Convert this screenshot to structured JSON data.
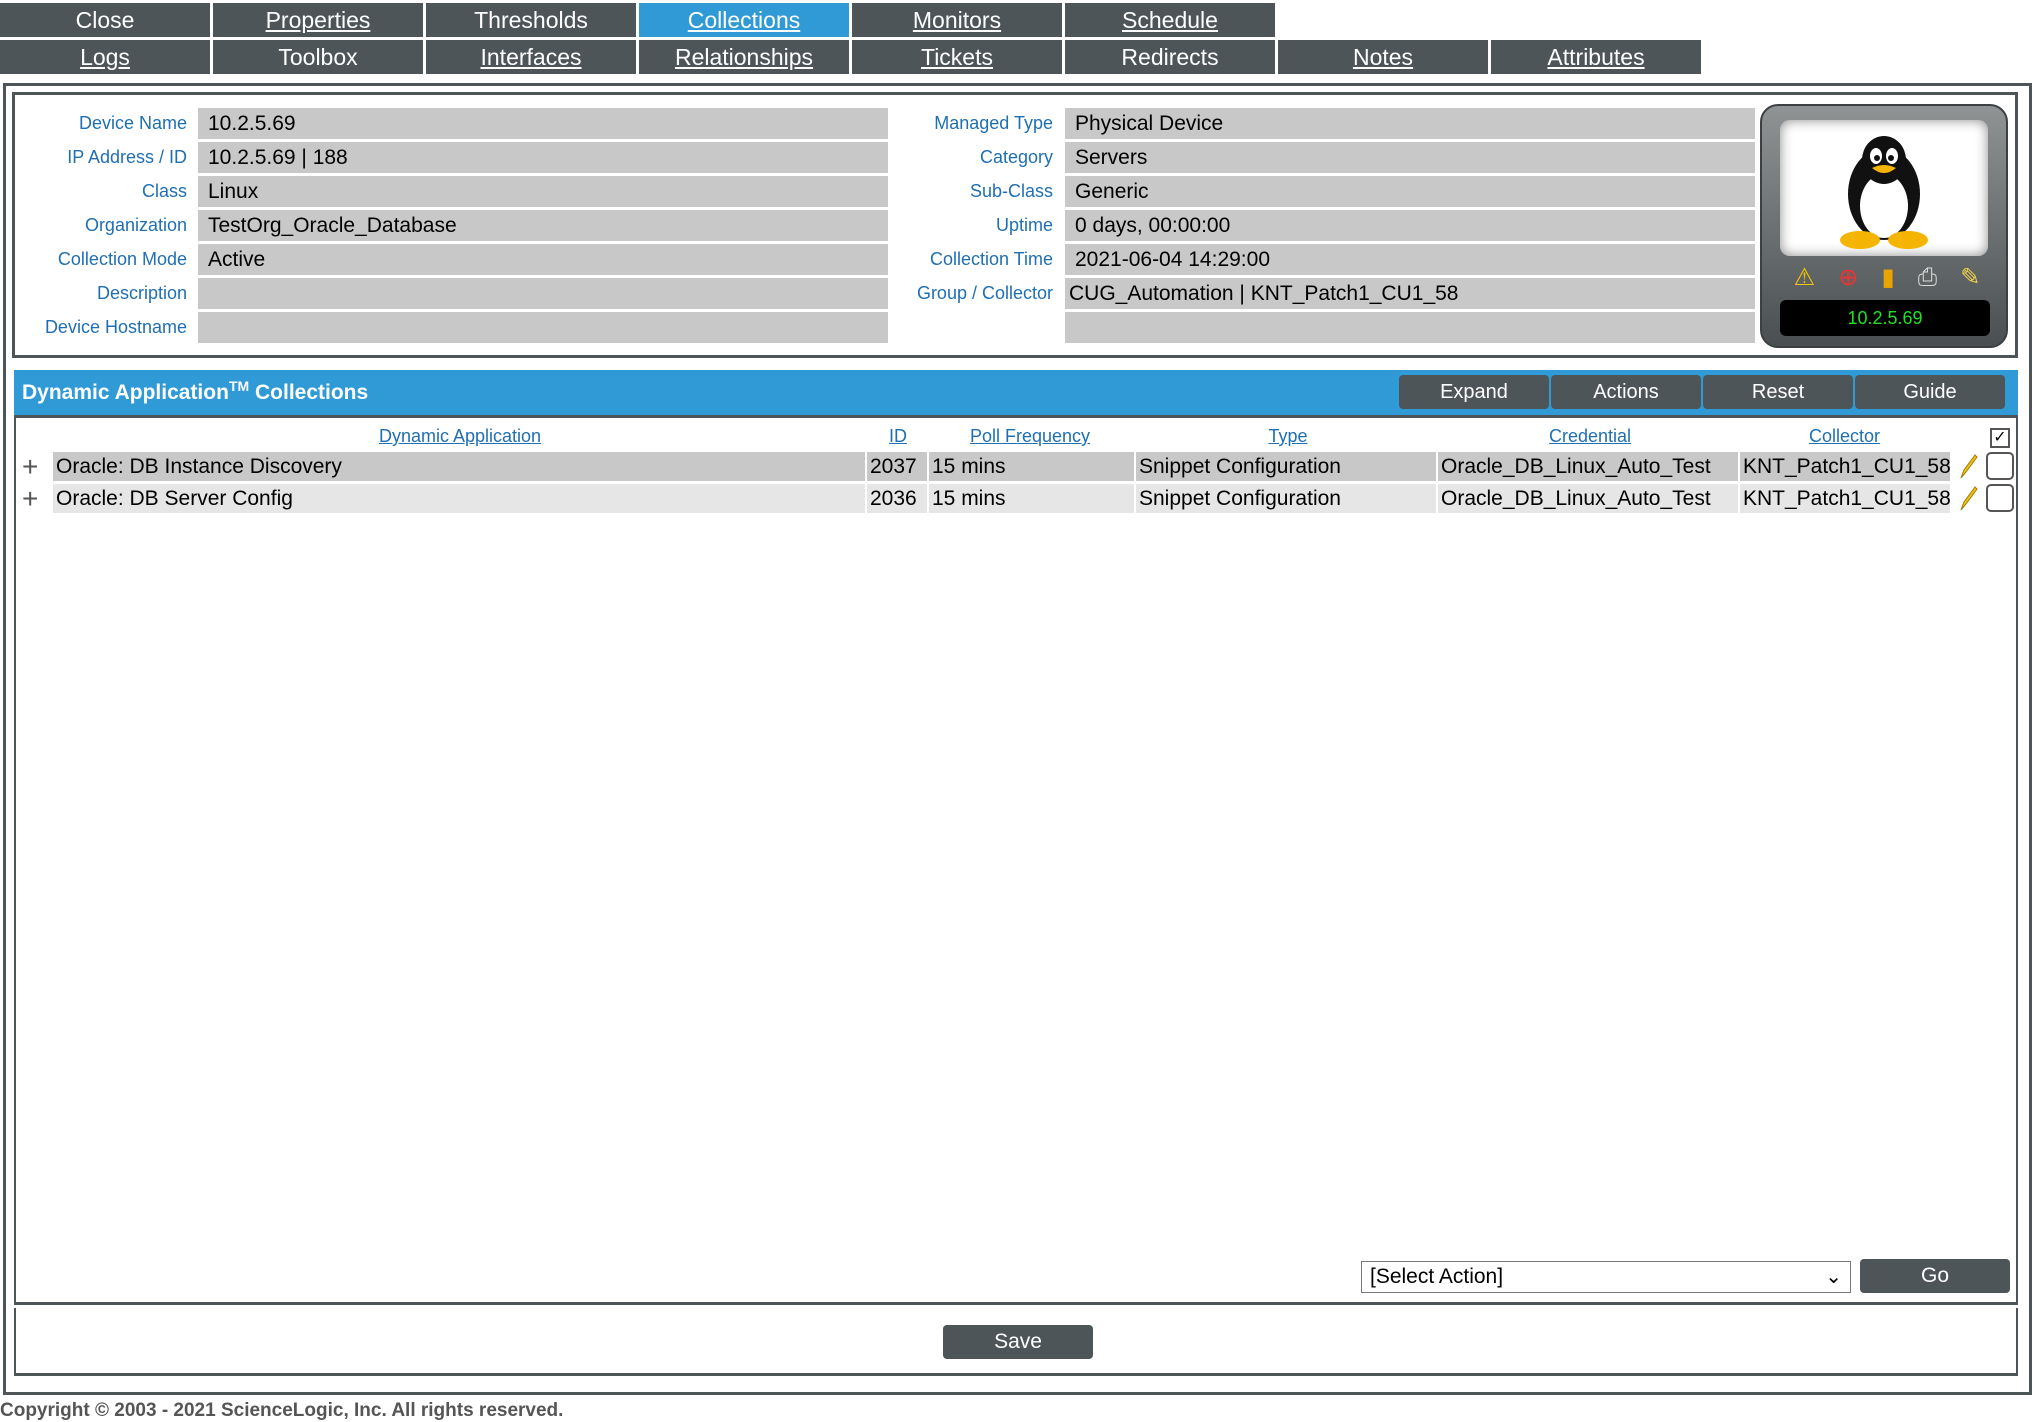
{
  "tabs_row1": [
    {
      "label": "Close",
      "active": false
    },
    {
      "label": "Properties",
      "active": false
    },
    {
      "label": "Thresholds",
      "active": false
    },
    {
      "label": "Collections",
      "active": true
    },
    {
      "label": "Monitors",
      "active": false
    },
    {
      "label": "Schedule",
      "active": false
    }
  ],
  "tabs_row2": [
    {
      "label": "Logs"
    },
    {
      "label": "Toolbox"
    },
    {
      "label": "Interfaces"
    },
    {
      "label": "Relationships"
    },
    {
      "label": "Tickets"
    },
    {
      "label": "Redirects"
    },
    {
      "label": "Notes"
    },
    {
      "label": "Attributes"
    }
  ],
  "device": {
    "left_labels": [
      "Device Name",
      "IP Address / ID",
      "Class",
      "Organization",
      "Collection Mode",
      "Description",
      "Device Hostname"
    ],
    "left_values": [
      "10.2.5.69",
      "10.2.5.69 | 188",
      "Linux",
      "TestOrg_Oracle_Database",
      "Active",
      "",
      ""
    ],
    "right_labels": [
      "Managed Type",
      "Category",
      "Sub-Class",
      "Uptime",
      "Collection Time",
      "Group / Collector"
    ],
    "right_values": [
      "Physical Device",
      "Servers",
      "Generic",
      "0 days, 00:00:00",
      "2021-06-04 14:29:00",
      "CUG_Automation | KNT_Patch1_CU1_58",
      ""
    ],
    "badge_ip": "10.2.5.69",
    "icon": "linux-penguin-icon"
  },
  "collections": {
    "title": "Dynamic Application",
    "title_sup": "TM",
    "title_suffix": " Collections",
    "buttons": [
      "Expand",
      "Actions",
      "Reset",
      "Guide"
    ],
    "columns": [
      "Dynamic Application",
      "ID",
      "Poll Frequency",
      "Type",
      "Credential",
      "Collector"
    ],
    "rows": [
      {
        "app": "Oracle: DB Instance Discovery",
        "id": "2037",
        "freq": "15 mins",
        "type": "Snippet Configuration",
        "credential": "Oracle_DB_Linux_Auto_Test",
        "collector": "KNT_Patch1_CU1_58"
      },
      {
        "app": "Oracle: DB Server Config",
        "id": "2036",
        "freq": "15 mins",
        "type": "Snippet Configuration",
        "credential": "Oracle_DB_Linux_Auto_Test",
        "collector": "KNT_Patch1_CU1_58"
      }
    ],
    "select_action": "[Select Action]",
    "go_label": "Go"
  },
  "save_label": "Save",
  "copyright": "Copyright © 2003 - 2021 ScienceLogic, Inc. All rights reserved.",
  "colors": {
    "tab": "#4e5559",
    "tab_active": "#2f9ad6",
    "label_blue": "#1f6fb2",
    "value_bg": "#c8c8c8"
  }
}
